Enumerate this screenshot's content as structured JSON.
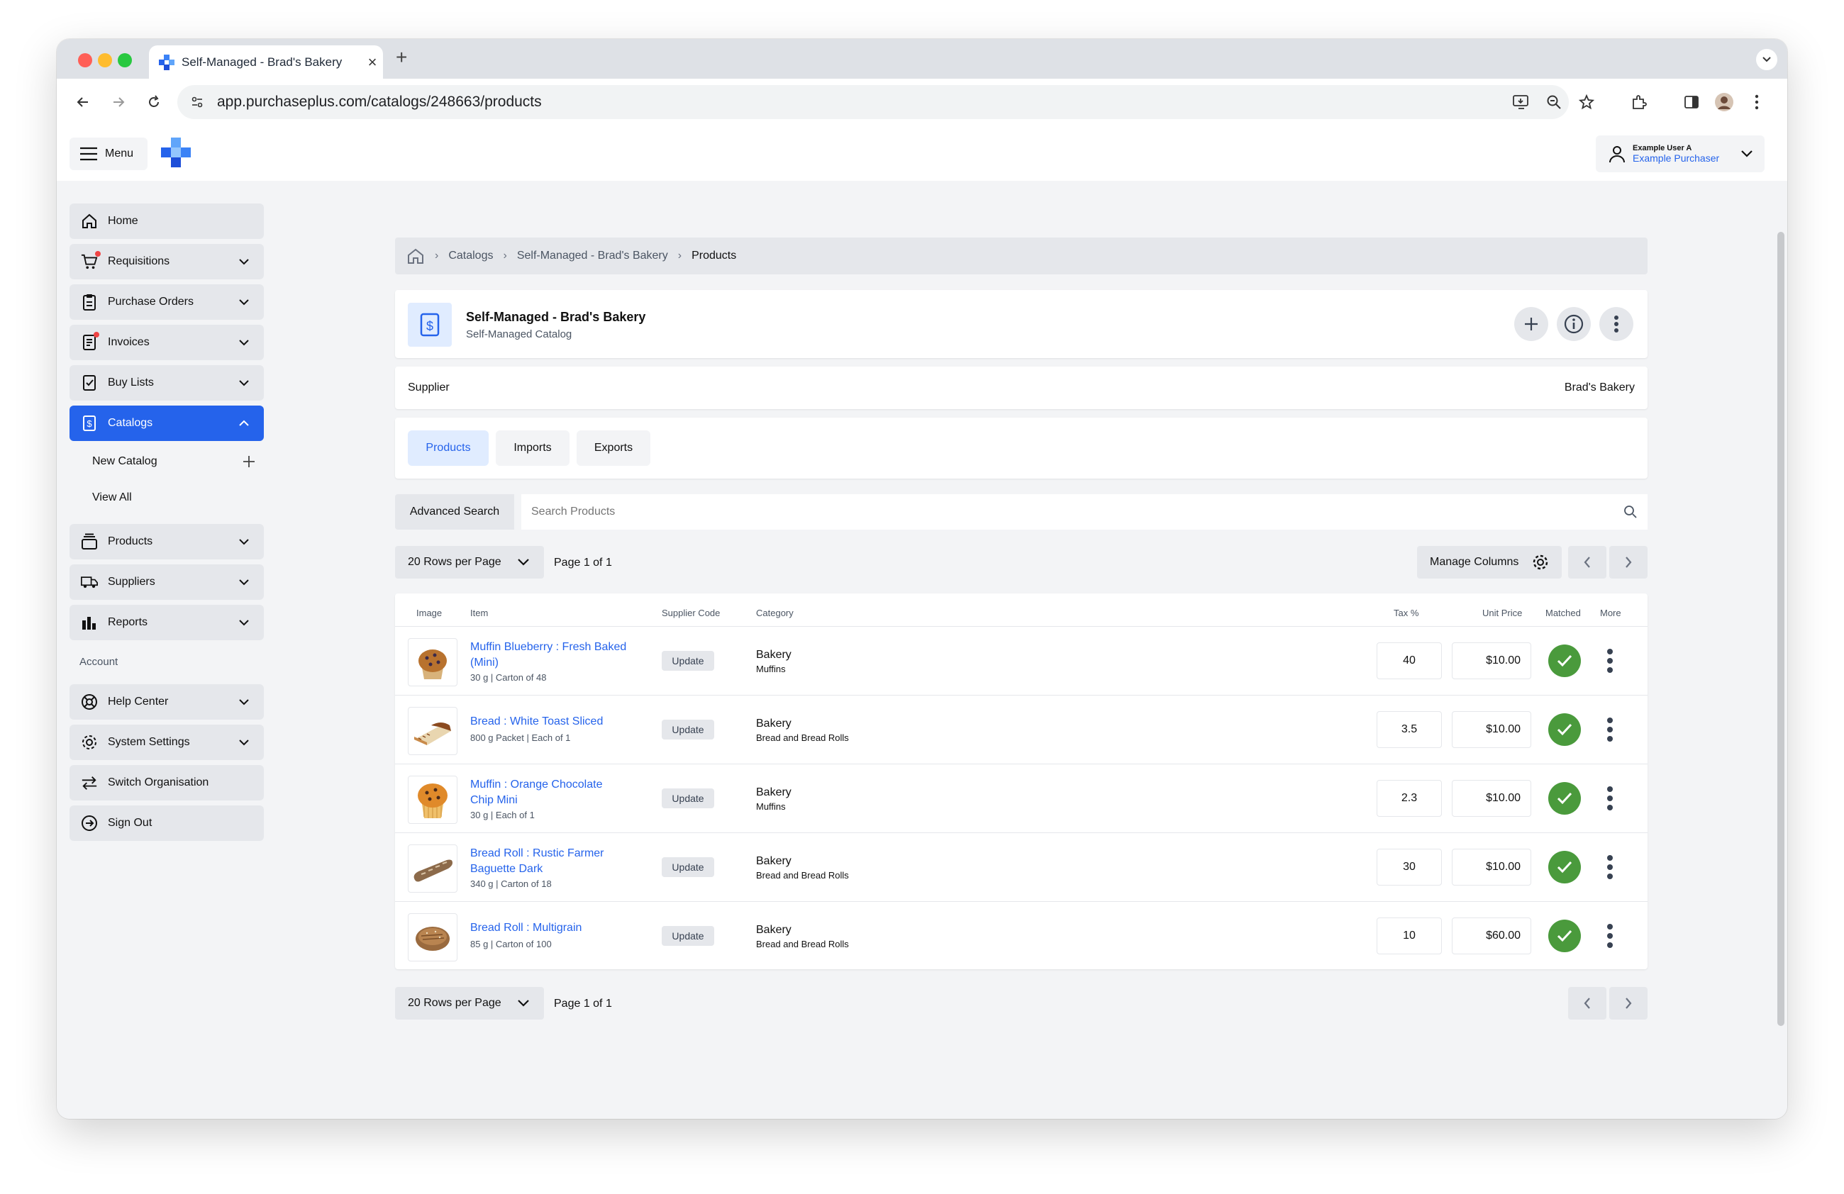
{
  "browser": {
    "tab_title": "Self-Managed - Brad's Bakery",
    "url": "app.purchaseplus.com/catalogs/248663/products"
  },
  "header": {
    "menu_label": "Menu",
    "user_name": "Example User A",
    "user_role": "Example Purchaser"
  },
  "sidebar": {
    "items": [
      {
        "label": "Home",
        "icon": "home-icon"
      },
      {
        "label": "Requisitions",
        "icon": "cart-icon"
      },
      {
        "label": "Purchase Orders",
        "icon": "clipboard-icon"
      },
      {
        "label": "Invoices",
        "icon": "invoice-icon"
      },
      {
        "label": "Buy Lists",
        "icon": "checklist-icon"
      },
      {
        "label": "Catalogs",
        "icon": "catalog-icon"
      },
      {
        "label": "Products",
        "icon": "box-icon"
      },
      {
        "label": "Suppliers",
        "icon": "truck-icon"
      },
      {
        "label": "Reports",
        "icon": "chart-icon"
      }
    ],
    "catalog_sub": {
      "new_catalog": "New Catalog",
      "view_all": "View All"
    },
    "account_label": "Account",
    "account_items": [
      {
        "label": "Help Center",
        "icon": "lifebuoy-icon"
      },
      {
        "label": "System Settings",
        "icon": "gear-icon"
      },
      {
        "label": "Switch Organisation",
        "icon": "switch-icon"
      },
      {
        "label": "Sign Out",
        "icon": "sign-out-icon"
      }
    ]
  },
  "breadcrumb": [
    "Catalogs",
    "Self-Managed - Brad's Bakery",
    "Products"
  ],
  "catalog": {
    "title": "Self-Managed - Brad's Bakery",
    "subtitle": "Self-Managed Catalog",
    "supplier_label": "Supplier",
    "supplier_value": "Brad's Bakery"
  },
  "tabs": [
    "Products",
    "Imports",
    "Exports"
  ],
  "search": {
    "advanced_label": "Advanced Search",
    "placeholder": "Search Products"
  },
  "pagination": {
    "rows_per_page": "20 Rows per Page",
    "page_info": "Page 1 of 1",
    "manage_columns": "Manage Columns"
  },
  "table": {
    "headers": {
      "image": "Image",
      "item": "Item",
      "supplier_code": "Supplier Code",
      "category": "Category",
      "tax": "Tax %",
      "unit_price": "Unit Price",
      "matched": "Matched",
      "more": "More"
    },
    "rows": [
      {
        "name_line1": "Muffin Blueberry : Fresh Baked",
        "name_line2": "(Mini)",
        "desc": "30 g | Carton of 48",
        "code": "Update",
        "cat": "Bakery",
        "subcat": "Muffins",
        "tax": "40",
        "price": "$10.00"
      },
      {
        "name_line1": "Bread : White Toast Sliced",
        "name_line2": "",
        "desc": "800 g Packet | Each of 1",
        "code": "Update",
        "cat": "Bakery",
        "subcat": "Bread and Bread Rolls",
        "tax": "3.5",
        "price": "$10.00"
      },
      {
        "name_line1": "Muffin : Orange Chocolate",
        "name_line2": "Chip Mini",
        "desc": "30 g | Each of 1",
        "code": "Update",
        "cat": "Bakery",
        "subcat": "Muffins",
        "tax": "2.3",
        "price": "$10.00"
      },
      {
        "name_line1": "Bread Roll : Rustic Farmer",
        "name_line2": "Baguette Dark",
        "desc": "340 g | Carton of 18",
        "code": "Update",
        "cat": "Bakery",
        "subcat": "Bread and Bread Rolls",
        "tax": "30",
        "price": "$10.00"
      },
      {
        "name_line1": "Bread Roll : Multigrain",
        "name_line2": "",
        "desc": "85 g | Carton of 100",
        "code": "Update",
        "cat": "Bakery",
        "subcat": "Bread and Bread Rolls",
        "tax": "10",
        "price": "$60.00"
      }
    ]
  },
  "colors": {
    "accent": "#2563eb",
    "matched": "#4a9a3c",
    "notification": "#ef4444"
  }
}
